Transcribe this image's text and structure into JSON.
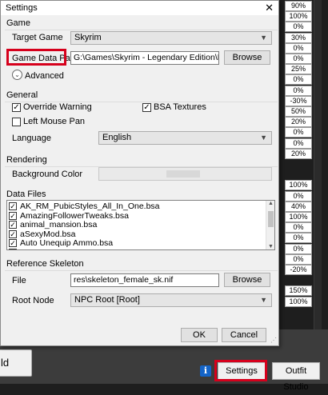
{
  "background": {
    "percentages": [
      "90%",
      "100%",
      "0%",
      "30%",
      "0%",
      "0%",
      "25%",
      "0%",
      "0%",
      "-30%",
      "50%",
      "20%",
      "0%",
      "0%",
      "20%",
      "",
      "",
      "100%",
      "0%",
      "40%",
      "100%",
      "0%",
      "0%",
      "0%",
      "0%",
      "-20%",
      "",
      "150%",
      "100%"
    ],
    "left_button_label": "ld",
    "info_icon": "i",
    "settings_button": "Settings",
    "outfit_studio_button": "Outfit Studio"
  },
  "dialog": {
    "title": "Settings",
    "close": "✕",
    "game": {
      "group_title": "Game",
      "target_game_label": "Target Game",
      "target_game_value": "Skyrim",
      "data_path_label": "Game Data Path",
      "data_path_value": "G:\\Games\\Skyrim - Legendary Edition\\Data\\",
      "browse": "Browse",
      "advanced": "Advanced"
    },
    "general": {
      "group_title": "General",
      "override_warning": "Override Warning",
      "override_checked": true,
      "bsa_textures": "BSA Textures",
      "bsa_checked": true,
      "left_mouse_pan": "Left Mouse Pan",
      "left_mouse_checked": false,
      "language_label": "Language",
      "language_value": "English"
    },
    "rendering": {
      "group_title": "Rendering",
      "background_color_label": "Background Color"
    },
    "data_files": {
      "group_title": "Data Files",
      "items": [
        {
          "name": "AK_RM_PubicStyles_All_In_One.bsa",
          "checked": true
        },
        {
          "name": "AmazingFollowerTweaks.bsa",
          "checked": true
        },
        {
          "name": "animal_mansion.bsa",
          "checked": true
        },
        {
          "name": "aSexyMod.bsa",
          "checked": true
        },
        {
          "name": "Auto Unequip Ammo.bsa",
          "checked": true
        },
        {
          "name": "",
          "checked": false
        }
      ]
    },
    "reference_skeleton": {
      "group_title": "Reference Skeleton",
      "file_label": "File",
      "file_value": "res\\skeleton_female_sk.nif",
      "browse": "Browse",
      "root_node_label": "Root Node",
      "root_node_value": "NPC Root [Root]"
    },
    "ok": "OK",
    "cancel": "Cancel"
  },
  "colors": {
    "highlight": "#d6001c",
    "dialog_bg": "#f0f0f0"
  }
}
